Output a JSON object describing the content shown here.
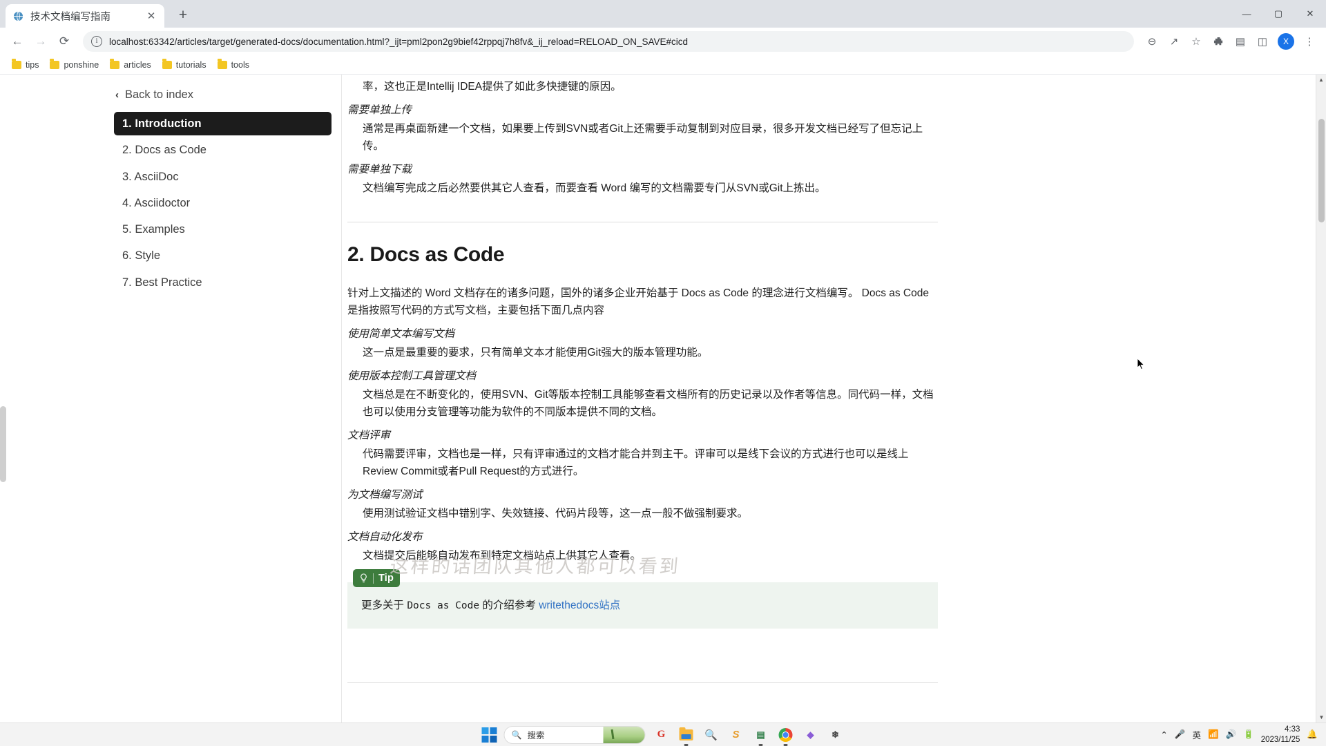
{
  "browser": {
    "tab": {
      "title": "技术文档编写指南",
      "favicon_icon": "globe-icon",
      "close_icon": "close-icon"
    },
    "new_tab_label": "+",
    "window_controls": {
      "minimize": "—",
      "maximize": "▢",
      "close": "✕"
    },
    "nav": {
      "back_icon": "arrow-left-icon",
      "forward_icon": "arrow-right-icon",
      "reload_icon": "reload-icon"
    },
    "omnibox": {
      "info_glyph": "i",
      "url_host": "localhost:63342",
      "url_rest": "/articles/target/generated-docs/documentation.html?_ijt=pml2pon2g9bief42rppqj7h8fv&_ij_reload=RELOAD_ON_SAVE#cicd",
      "url_full": "localhost:63342/articles/target/generated-docs/documentation.html?_ijt=pml2pon2g9bief42rppqj7h8fv&_ij_reload=RELOAD_ON_SAVE#cicd"
    },
    "toolbar_icons": {
      "zoom": "⊖",
      "share": "↗",
      "bookmark_star": "☆",
      "extensions": "🧩",
      "reading_list": "▤",
      "side_panel": "◫",
      "profile_initial": "X",
      "menu": "⋮"
    },
    "bookmarks": [
      {
        "label": "tips",
        "icon": "folder-icon"
      },
      {
        "label": "ponshine",
        "icon": "folder-icon"
      },
      {
        "label": "articles",
        "icon": "folder-icon"
      },
      {
        "label": "tutorials",
        "icon": "folder-icon"
      },
      {
        "label": "tools",
        "icon": "folder-icon"
      }
    ]
  },
  "sidebar": {
    "back_label": "Back to index",
    "back_icon": "chevron-left-icon",
    "items": [
      {
        "label": "1. Introduction",
        "active": true
      },
      {
        "label": "2. Docs as Code",
        "active": false
      },
      {
        "label": "3. AsciiDoc",
        "active": false
      },
      {
        "label": "4. Asciidoctor",
        "active": false
      },
      {
        "label": "5. Examples",
        "active": false
      },
      {
        "label": "6. Style",
        "active": false
      },
      {
        "label": "7. Best Practice",
        "active": false
      }
    ]
  },
  "content": {
    "top_paragraph": "率，这也正是Intellij IDEA提供了如此多快捷键的原因。",
    "top_terms": [
      {
        "term": "需要单独上传",
        "desc": "通常是再桌面新建一个文档，如果要上传到SVN或者Git上还需要手动复制到对应目录，很多开发文档已经写了但忘记上传。"
      },
      {
        "term": "需要单独下载",
        "desc": "文档编写完成之后必然要供其它人查看，而要查看 Word 编写的文档需要专门从SVN或Git上拣出。"
      }
    ],
    "section_heading": "2. Docs as Code",
    "section_intro": "针对上文描述的 Word 文档存在的诸多问题，国外的诸多企业开始基于 Docs as Code 的理念进行文档编写。 Docs as Code 是指按照写代码的方式写文档，主要包括下面几点内容",
    "terms": [
      {
        "term": "使用简单文本编写文档",
        "desc": "这一点是最重要的要求，只有简单文本才能使用Git强大的版本管理功能。"
      },
      {
        "term": "使用版本控制工具管理文档",
        "desc": "文档总是在不断变化的，使用SVN、Git等版本控制工具能够查看文档所有的历史记录以及作者等信息。同代码一样，文档也可以使用分支管理等功能为软件的不同版本提供不同的文档。"
      },
      {
        "term": "文档评审",
        "desc": "代码需要评审，文档也是一样，只有评审通过的文档才能合并到主干。评审可以是线下会议的方式进行也可以是线上Review Commit或者Pull Request的方式进行。"
      },
      {
        "term": "为文档编写测试",
        "desc": "使用测试验证文档中错别字、失效链接、代码片段等，这一点一般不做强制要求。"
      },
      {
        "term": "文档自动化发布",
        "desc": "文档提交后能够自动发布到特定文档站点上供其它人查看。"
      }
    ],
    "admonition": {
      "type": "Tip",
      "icon": "lightbulb-icon",
      "text_before": "更多关于 ",
      "code_text": "Docs as Code",
      "text_middle": " 的介绍参考 ",
      "link_text": "writethedocs站点",
      "accent_color": "#3d7c3d",
      "background_color": "#eef4ef"
    },
    "handwritten_note": "这样的话团队其他人都可以看到"
  },
  "taskbar": {
    "start_icon": "windows-start-icon",
    "search_placeholder": "搜索",
    "search_icon": "search-icon",
    "apps": [
      {
        "name": "wechat-app",
        "glyph": "G",
        "color": "#d93025",
        "running": false
      },
      {
        "name": "file-explorer-app",
        "glyph": "",
        "color": "#f6b73c",
        "running": true
      },
      {
        "name": "everything-search-app",
        "glyph": "🔍",
        "color": "#e8a33d",
        "running": false
      },
      {
        "name": "sublime-text-app",
        "glyph": "S",
        "color": "#e79c2b",
        "running": false
      },
      {
        "name": "terminal-app",
        "glyph": "▤",
        "color": "#2d7d46",
        "running": true
      },
      {
        "name": "chrome-app",
        "glyph": "",
        "color": "#4285f4",
        "running": true
      },
      {
        "name": "app-seven",
        "glyph": "◆",
        "color": "#8a5cd6",
        "running": false
      },
      {
        "name": "app-eight",
        "glyph": "❄",
        "color": "#444",
        "running": false
      }
    ],
    "tray": {
      "chevron": "⌃",
      "mic_icon": "microphone-icon",
      "ime_label": "英",
      "wifi_icon": "wifi-icon",
      "volume_icon": "volume-icon",
      "battery_icon": "battery-icon",
      "time": "4:33",
      "date": "2023/11/25",
      "notification_icon": "bell-icon"
    }
  }
}
